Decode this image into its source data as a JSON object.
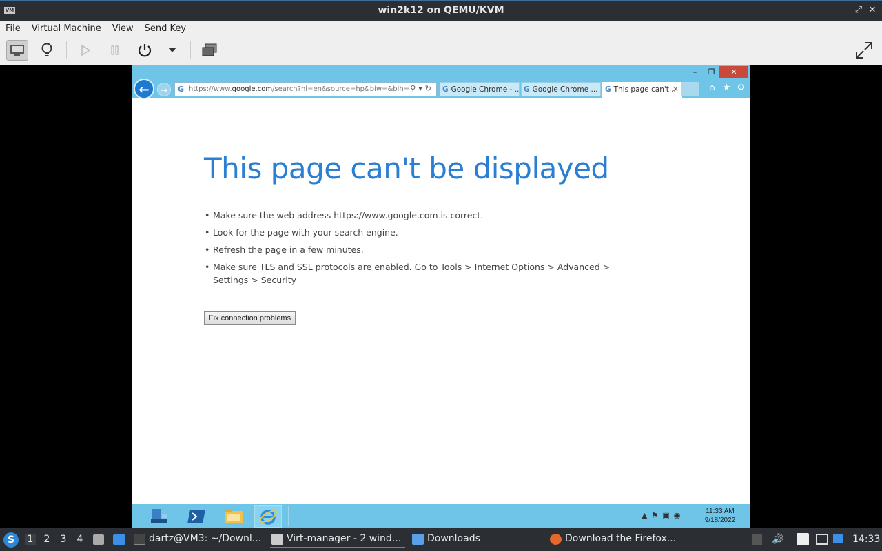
{
  "host_window": {
    "title": "win2k12 on QEMU/KVM",
    "app_icon": "VM",
    "menu": [
      "File",
      "Virtual Machine",
      "View",
      "Send Key"
    ]
  },
  "toolbar": {
    "icons": [
      "console-icon",
      "details-lightbulb-icon",
      "run-play-icon",
      "pause-icon",
      "power-icon",
      "power-dropdown-icon",
      "snapshots-icon",
      "fullscreen-icon"
    ]
  },
  "ie": {
    "url_prefix": "https://www.",
    "url_domain": "google.com",
    "url_rest": "/search?hl=en&source=hp&biw=&bih=&",
    "tabs": [
      {
        "label": "Google Chrome - ...",
        "active": false
      },
      {
        "label": "Google Chrome ...",
        "active": false
      },
      {
        "label": "This page can't...",
        "active": true
      }
    ],
    "heading": "This page can't be displayed",
    "bullets": [
      "Make sure the web address https://www.google.com is correct.",
      "Look for the page with your search engine.",
      "Refresh the page in a few minutes.",
      "Make sure TLS and SSL protocols are enabled. Go to Tools > Internet Options > Advanced > Settings > Security"
    ],
    "fix_button": "Fix connection problems"
  },
  "win_taskbar": {
    "clock_time": "11:33 AM",
    "clock_date": "9/18/2022"
  },
  "host_taskbar": {
    "workspaces": [
      "1",
      "2",
      "3",
      "4"
    ],
    "tasks": [
      {
        "label": "dartz@VM3: ~/Downl...",
        "icon": "terminal-icon"
      },
      {
        "label": "Virt-manager - 2 wind...",
        "icon": "virt-manager-icon"
      },
      {
        "label": "Downloads",
        "icon": "folder-icon"
      },
      {
        "label": "Download the Firefox...",
        "icon": "firefox-icon"
      }
    ],
    "clock": "14:33"
  },
  "colors": {
    "ie_chrome": "#6ec5e8",
    "heading_blue": "#2a7ed3",
    "host_dark": "#2b2f33"
  }
}
